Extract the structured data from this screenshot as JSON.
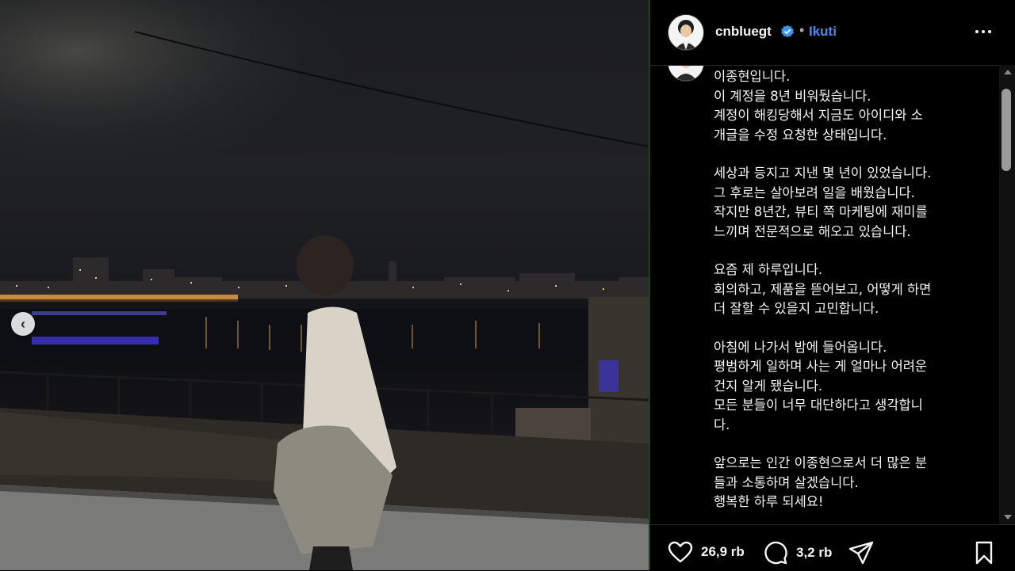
{
  "post": {
    "username": "cnbluegt",
    "separator": "•",
    "follow_label": "Ikuti",
    "caption_blocks": [
      [
        "이종현입니다.",
        "이 계정을 8년 비워뒀습니다.",
        "계정이 해킹당해서 지금도 아이디와 소",
        "개글을 수정 요청한 상태입니다."
      ],
      [
        "세상과 등지고 지낸 몇 년이 있었습니다.",
        "그 후로는 살아보려 일을 배웠습니다.",
        "작지만 8년간, 뷰티 쪽 마케팅에 재미를",
        "느끼며 전문적으로 해오고 있습니다."
      ],
      [
        "요즘 제 하루입니다.",
        "회의하고, 제품을 뜯어보고, 어떻게 하면",
        "더 잘할 수 있을지 고민합니다."
      ],
      [
        "아침에 나가서 밤에 들어옵니다.",
        "평범하게 일하며 사는 게 얼마나 어려운",
        "건지 알게 됐습니다.",
        "모든 분들이 너무 대단하다고 생각합니",
        "다."
      ],
      [
        "앞으로는 인간 이종현으로서 더 많은 분",
        "들과 소통하며 살겠습니다.",
        "행복한 하루 되세요!"
      ]
    ]
  },
  "actions": {
    "likes": "26,9 rb",
    "comments": "3,2 rb"
  },
  "icons": {
    "verified": "verified-badge-icon",
    "more": "more-options-icon",
    "like": "heart-icon",
    "comment": "comment-icon",
    "share": "share-icon",
    "save": "bookmark-icon",
    "prev": "chevron-left-icon"
  },
  "colors": {
    "follow": "#4a8cf7",
    "verified": "#3897f0",
    "background": "#000000"
  }
}
